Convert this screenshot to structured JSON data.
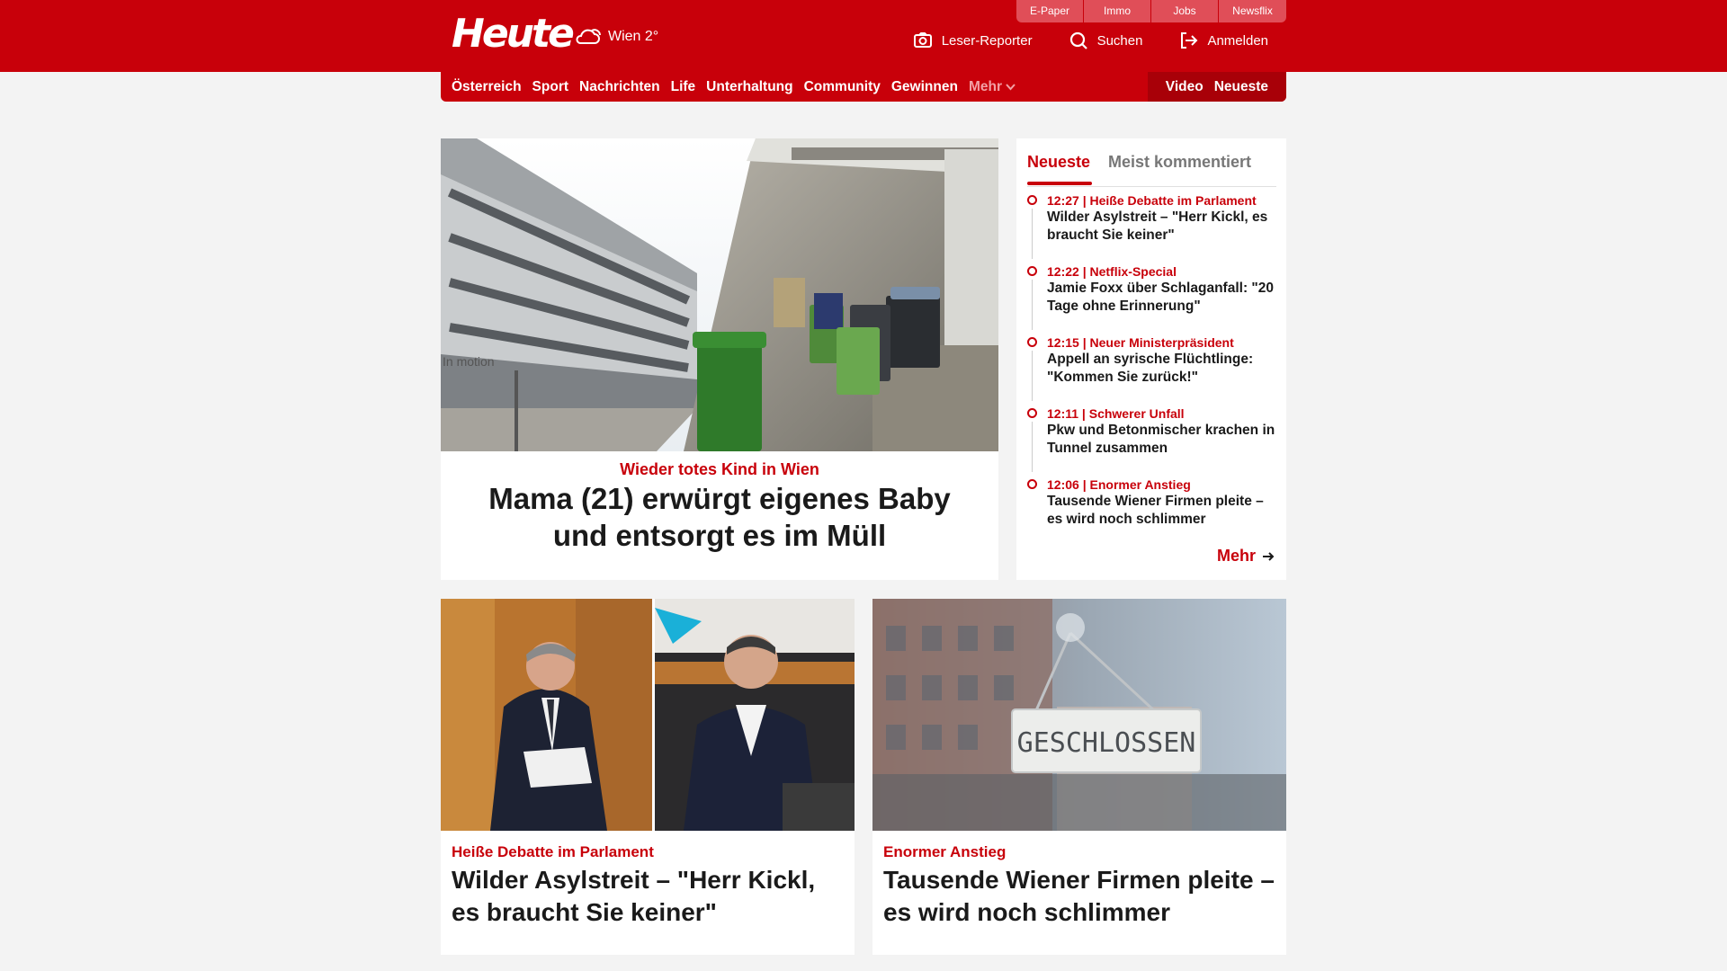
{
  "header": {
    "logo": "Heute",
    "weather": "Wien 2°",
    "service_tabs": [
      "E-Paper",
      "Immo",
      "Jobs",
      "Newsflix"
    ],
    "actions": [
      {
        "icon": "camera-icon",
        "label": "Leser-Reporter"
      },
      {
        "icon": "search-icon",
        "label": "Suchen"
      },
      {
        "icon": "login-icon",
        "label": "Anmelden"
      }
    ]
  },
  "nav": {
    "items": [
      "Österreich",
      "Sport",
      "Nachrichten",
      "Life",
      "Unterhaltung",
      "Community",
      "Gewinnen"
    ],
    "more": "Mehr",
    "right": [
      "Video",
      "Neueste"
    ]
  },
  "hero": {
    "kicker": "Wieder totes Kind in Wien",
    "headline": "Mama (21) erwürgt eigenes Baby und entsorgt es im Müll",
    "image_text": "In motion"
  },
  "sidebar": {
    "tabs": [
      "Neueste",
      "Meist kommentiert"
    ],
    "items": [
      {
        "meta": "12:27 | Heiße Debatte im Parlament",
        "title": "Wilder Asylstreit – \"Herr Kickl, es braucht Sie keiner\""
      },
      {
        "meta": "12:22 | Netflix-Special",
        "title": "Jamie Foxx über Schlaganfall: \"20 Tage ohne Erinnerung\""
      },
      {
        "meta": "12:15 | Neuer Ministerpräsident",
        "title": "Appell an syrische Flüchtlinge: \"Kommen Sie zurück!\""
      },
      {
        "meta": "12:11 | Schwerer Unfall",
        "title": "Pkw und Betonmischer krachen in Tunnel zusammen"
      },
      {
        "meta": "12:06 | Enormer Anstieg",
        "title": "Tausende Wiener Firmen pleite – es wird noch schlimmer"
      }
    ],
    "more": "Mehr"
  },
  "cards": [
    {
      "kicker": "Heiße Debatte im Parlament",
      "headline": "Wilder Asylstreit – \"Herr Kickl, es braucht Sie keiner\""
    },
    {
      "kicker": "Enormer Anstieg",
      "headline": "Tausende Wiener Firmen pleite – es wird noch schlimmer",
      "image_text": "GESCHLOSSEN"
    }
  ],
  "colors": {
    "brand": "#c8000a",
    "background": "#f3f3f3"
  }
}
